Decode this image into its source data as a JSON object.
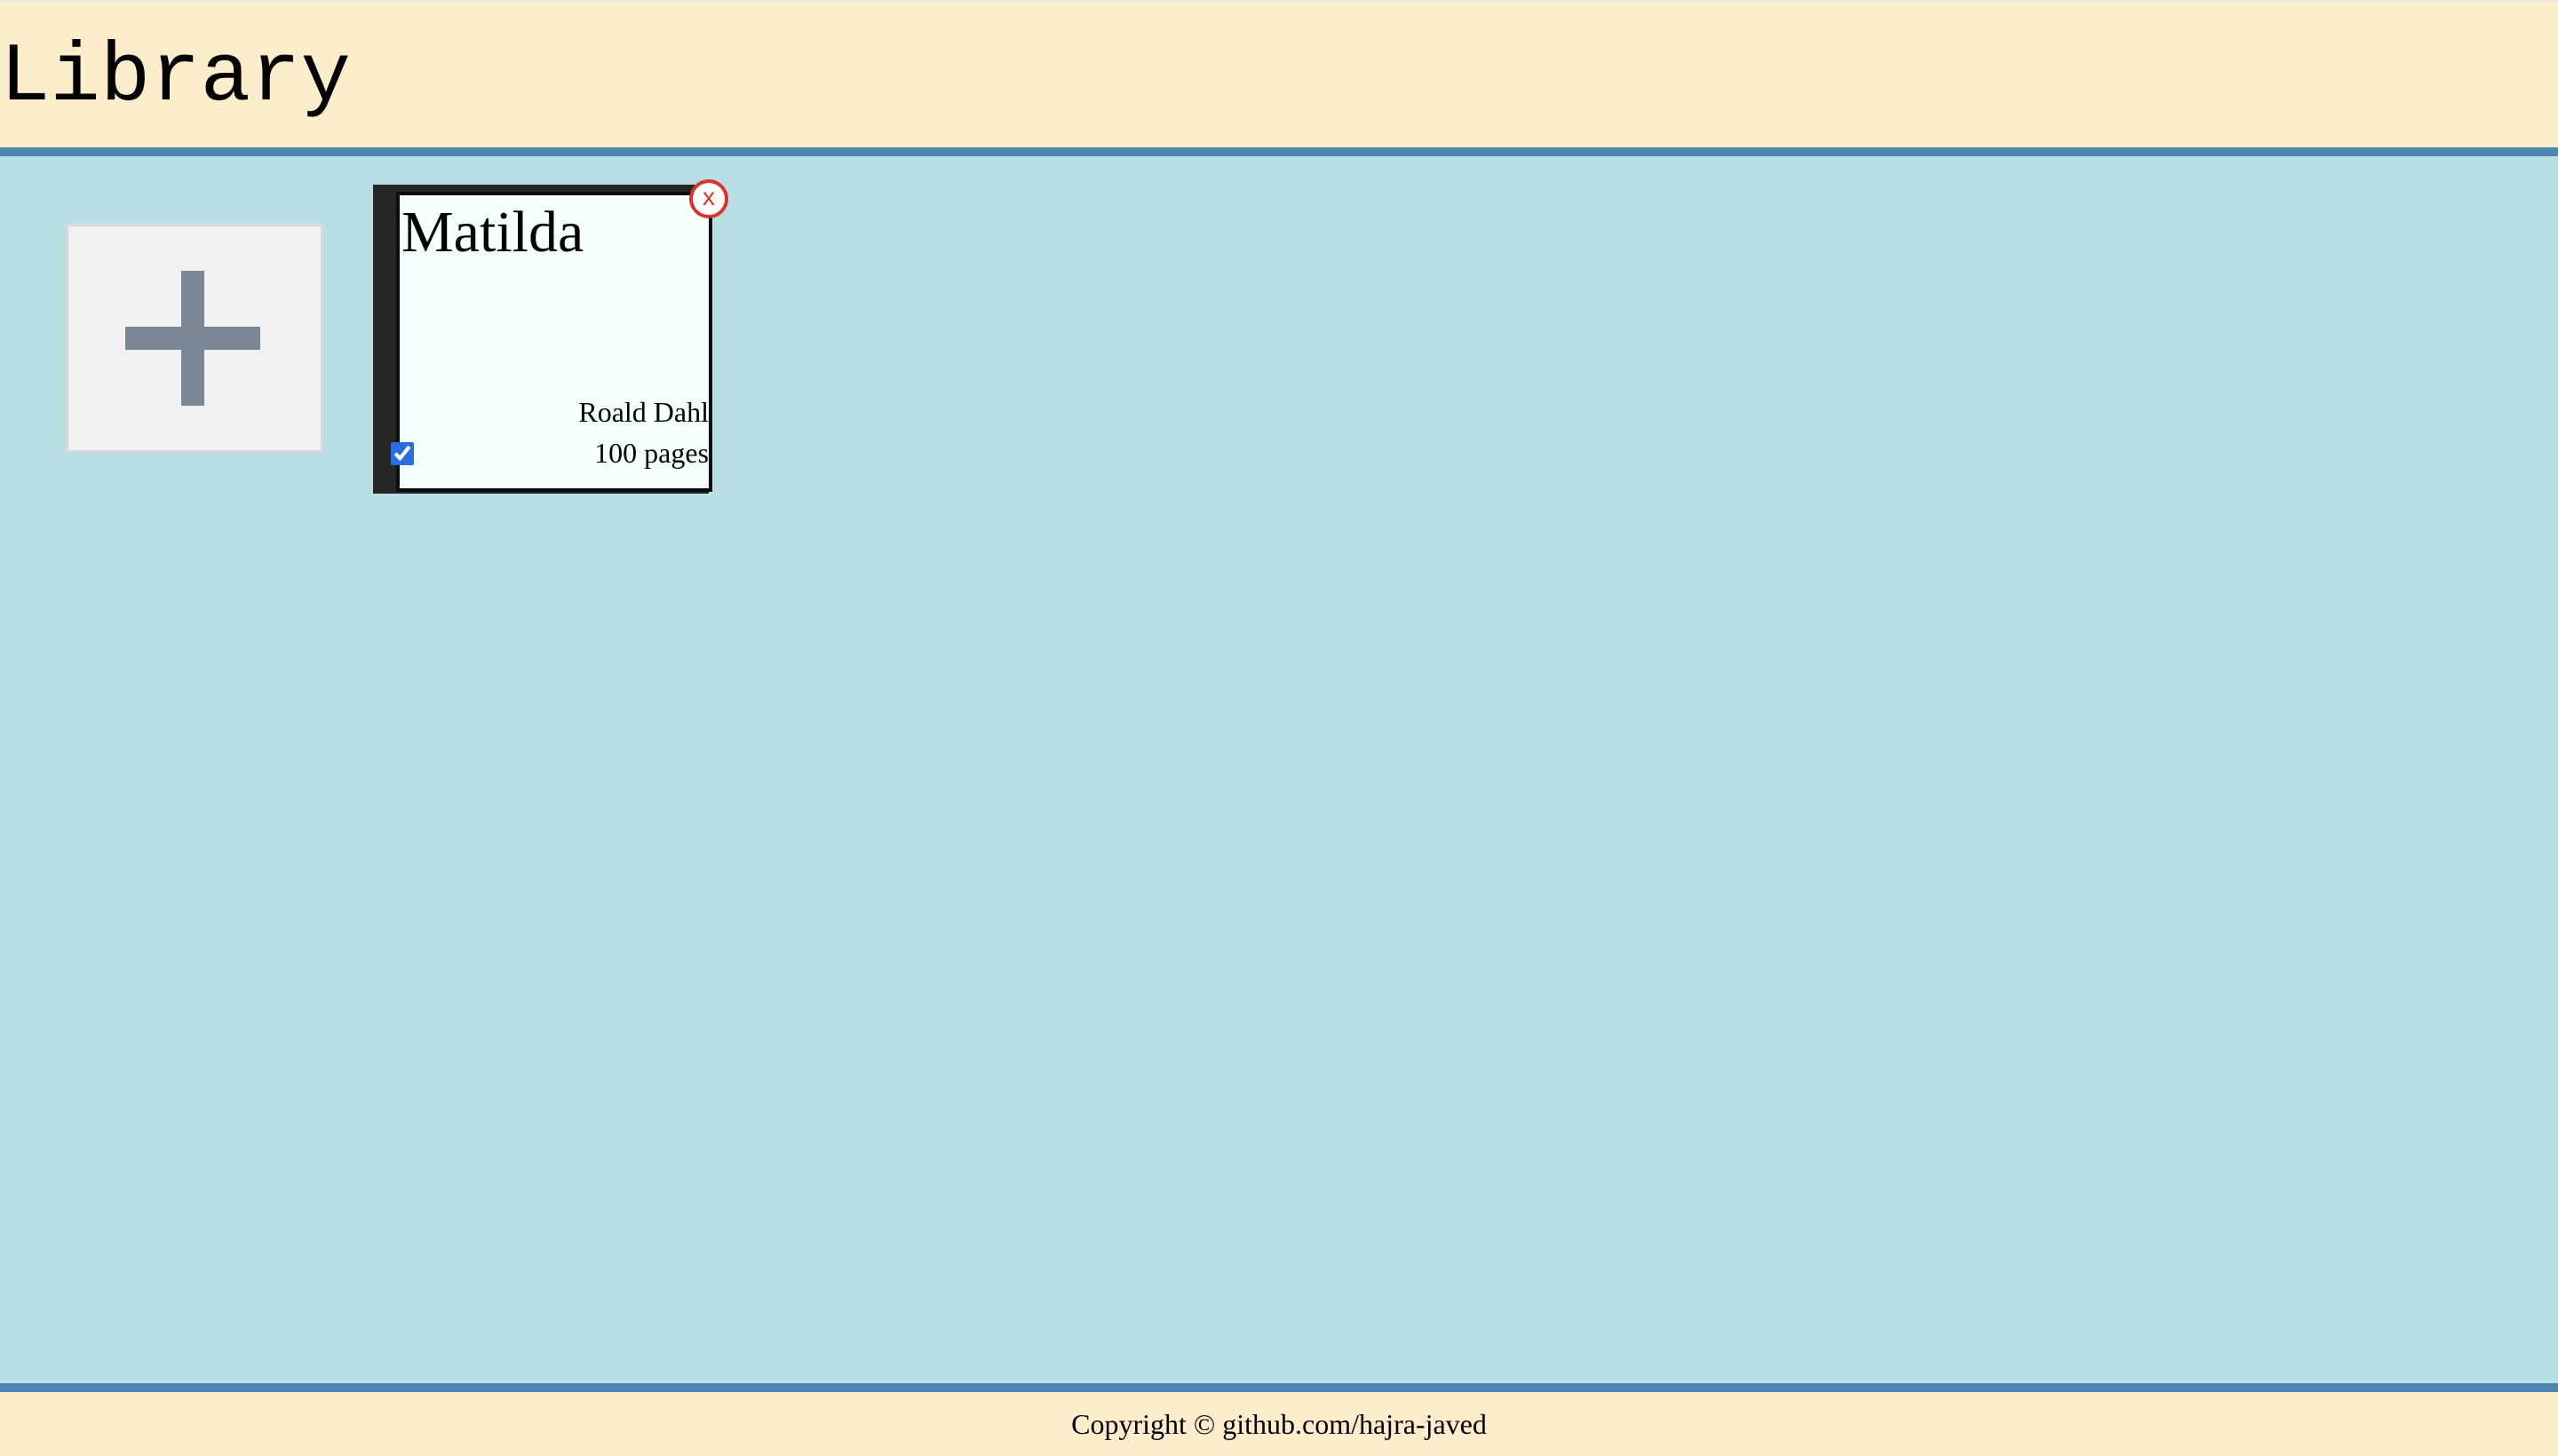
{
  "header": {
    "title": "Library"
  },
  "library": {
    "add_book": {
      "icon": "plus-icon",
      "color": "#7a8896"
    },
    "books": [
      {
        "title": "Matilda",
        "author": "Roald Dahl",
        "pages": "100 pages",
        "read": true,
        "remove_label": "x"
      }
    ]
  },
  "footer": {
    "copyright": "Copyright © github.com/hajra-javed"
  },
  "colors": {
    "header_background": "#feedcc",
    "rule": "#4e83b1",
    "main_background": "#b9dee4",
    "remove_button": "#d8342b",
    "checkbox": "#2a6fe0"
  }
}
